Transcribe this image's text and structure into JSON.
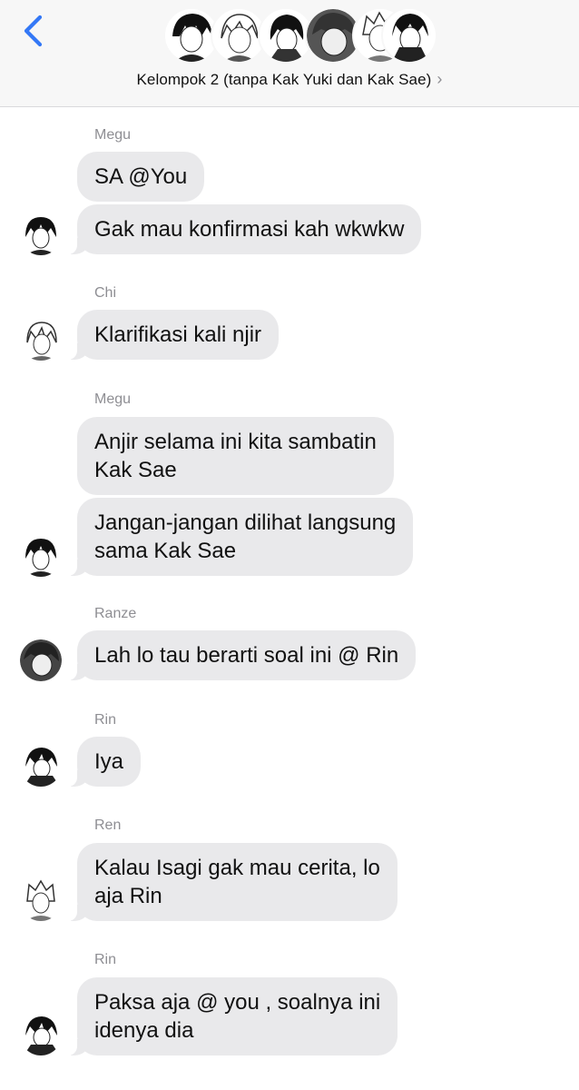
{
  "header": {
    "group_name": "Kelompok 2 (tanpa Kak Yuki dan Kak Sae)",
    "accent_color": "#3478f6",
    "back_icon": "chevron-left-icon",
    "detail_icon": "chevron-right-icon",
    "member_avatar_count": 6
  },
  "messages": [
    {
      "sender": "Megu",
      "bubbles": [
        "SA @You",
        "Gak mau konfirmasi kah wkwkw"
      ]
    },
    {
      "sender": "Chi",
      "bubbles": [
        "Klarifikasi kali njir"
      ]
    },
    {
      "sender": "Megu",
      "bubbles": [
        [
          "Anjir selama ini kita sambatin",
          "Kak Sae"
        ],
        [
          "Jangan-jangan dilihat langsung",
          "sama Kak Sae"
        ]
      ]
    },
    {
      "sender": "Ranze",
      "bubbles": [
        "Lah lo tau berarti soal ini @ Rin"
      ]
    },
    {
      "sender": "Rin",
      "bubbles": [
        "Iya"
      ]
    },
    {
      "sender": "Ren",
      "bubbles": [
        [
          "Kalau Isagi gak mau cerita, lo",
          "aja Rin"
        ]
      ]
    },
    {
      "sender": "Rin",
      "bubbles": [
        [
          "Paksa aja @ you , soalnya ini",
          "idenya dia"
        ]
      ]
    }
  ],
  "colors": {
    "bubble_bg": "#e9e9eb",
    "sender_text": "#8e8e93",
    "header_bg": "#f7f7f7"
  }
}
